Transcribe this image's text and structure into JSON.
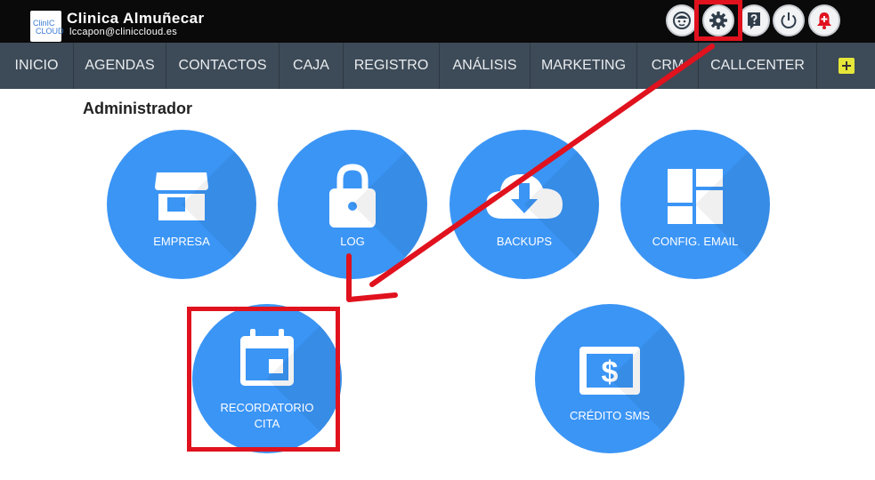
{
  "header": {
    "logo_line1": "ClinIC",
    "logo_line2": "CLOUD",
    "clinic_name": "Clinica Almuñecar",
    "email": "lccapon@cliniccloud.es",
    "icons": [
      "user-face-icon",
      "gear-icon",
      "help-icon",
      "power-icon",
      "alert-bell-icon"
    ]
  },
  "nav": {
    "items": [
      "INICIO",
      "AGENDAS",
      "CONTACTOS",
      "CAJA",
      "REGISTRO",
      "ANÁLISIS",
      "MARKETING",
      "CRM",
      "CALLCENTER"
    ],
    "plus_icon": "plus-icon"
  },
  "main": {
    "section_title": "Administrador",
    "tiles": [
      {
        "label": "EMPRESA",
        "icon": "store-icon"
      },
      {
        "label": "LOG",
        "icon": "lock-icon"
      },
      {
        "label": "BACKUPS",
        "icon": "cloud-download-icon"
      },
      {
        "label": "CONFIG. EMAIL",
        "icon": "layout-icon"
      },
      {
        "label_line1": "RECORDATORIO",
        "label_line2": "CITA",
        "icon": "calendar-icon"
      },
      {
        "label": "CRÉDITO SMS",
        "icon": "money-icon"
      }
    ]
  },
  "colors": {
    "topbar": "#0a0a0a",
    "navbar": "#3d4a57",
    "tile": "#3b95f5",
    "annotation": "#e0121e",
    "plus": "#e6e63a"
  }
}
